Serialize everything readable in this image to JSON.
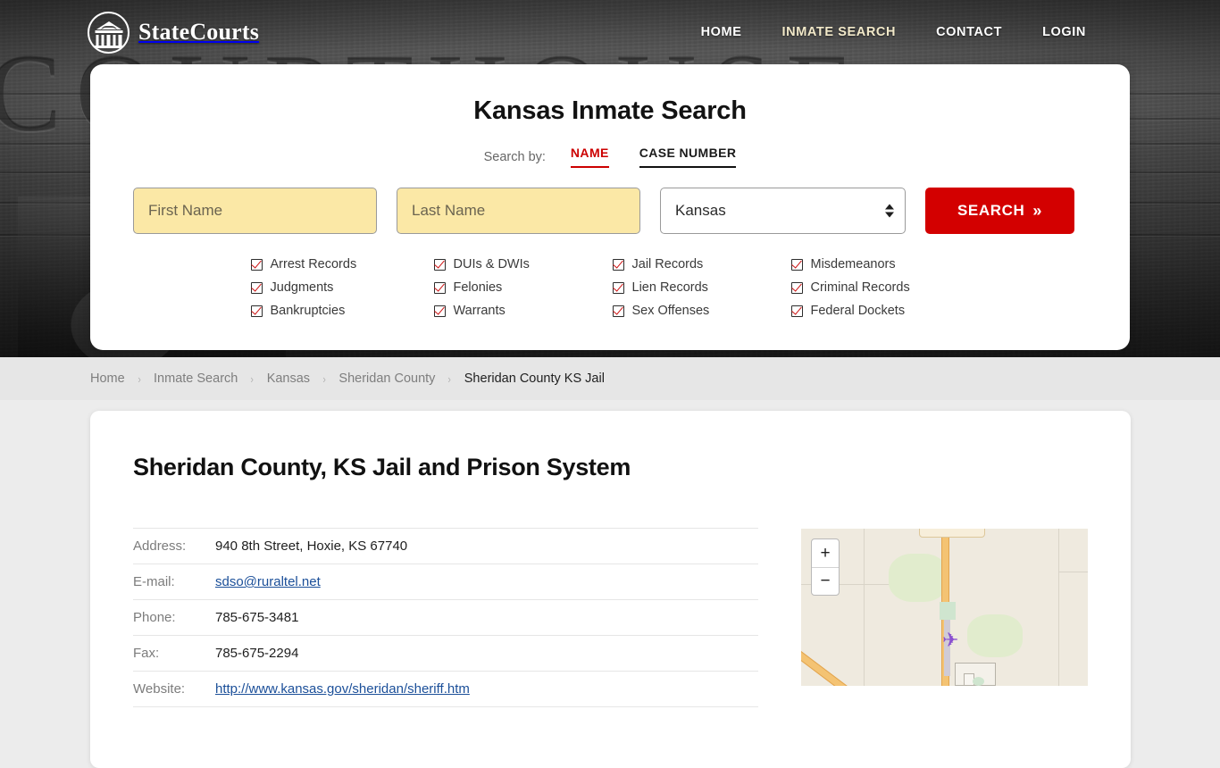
{
  "brand": {
    "name": "StateCourts",
    "logo_icon": "courthouse-circle-icon"
  },
  "nav": [
    {
      "label": "HOME",
      "active": false
    },
    {
      "label": "INMATE SEARCH",
      "active": true
    },
    {
      "label": "CONTACT",
      "active": false
    },
    {
      "label": "LOGIN",
      "active": false
    }
  ],
  "hero": {
    "watermark": "COURTHOUSE"
  },
  "search": {
    "title": "Kansas Inmate Search",
    "search_by_label": "Search by:",
    "tabs": [
      {
        "label": "NAME",
        "active": true
      },
      {
        "label": "CASE NUMBER",
        "active": false
      }
    ],
    "first_name_placeholder": "First Name",
    "first_name_value": "",
    "last_name_placeholder": "Last Name",
    "last_name_value": "",
    "state_selected": "Kansas",
    "state_options": [
      "Kansas"
    ],
    "button_label": "SEARCH",
    "button_icon": "double-chevron-right-icon",
    "accent_red": "#d30000",
    "field_highlight": "#fbe8a6",
    "checks": [
      "Arrest Records",
      "DUIs & DWIs",
      "Jail Records",
      "Misdemeanors",
      "Judgments",
      "Felonies",
      "Lien Records",
      "Criminal Records",
      "Bankruptcies",
      "Warrants",
      "Sex Offenses",
      "Federal Dockets"
    ]
  },
  "breadcrumb": {
    "separator": "›",
    "items": [
      {
        "label": "Home",
        "current": false
      },
      {
        "label": "Inmate Search",
        "current": false
      },
      {
        "label": "Kansas",
        "current": false
      },
      {
        "label": "Sheridan County",
        "current": false
      },
      {
        "label": "Sheridan County KS Jail",
        "current": true
      }
    ]
  },
  "facility": {
    "title": "Sheridan County, KS Jail and Prison System",
    "rows": [
      {
        "key": "Address:",
        "value": "940 8th Street, Hoxie, KS 67740",
        "link": false
      },
      {
        "key": "E-mail:",
        "value": "sdso@ruraltel.net",
        "link": true
      },
      {
        "key": "Phone:",
        "value": "785-675-3481",
        "link": false
      },
      {
        "key": "Fax:",
        "value": "785-675-2294",
        "link": false
      },
      {
        "key": "Website:",
        "value": "http://www.kansas.gov/sheridan/sheriff.htm",
        "link": true
      }
    ]
  },
  "map": {
    "zoom_in_label": "+",
    "zoom_out_label": "−",
    "marker_icon": "airplane-icon"
  }
}
